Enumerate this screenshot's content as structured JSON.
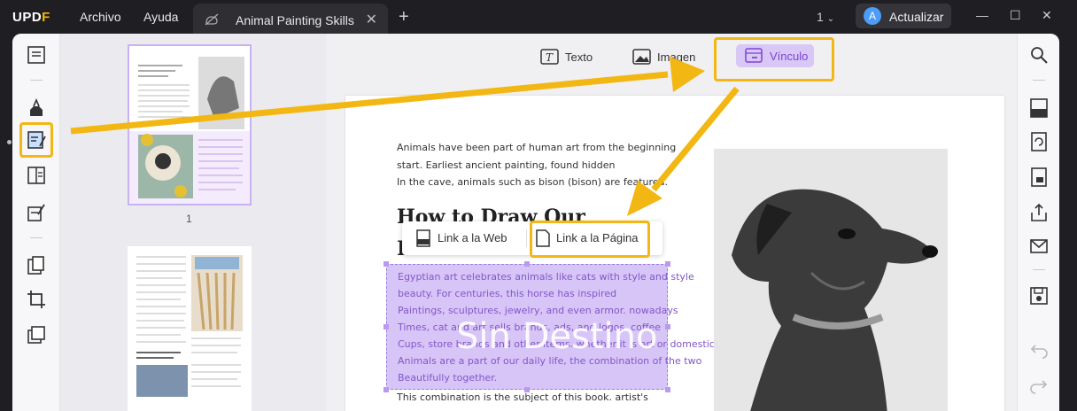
{
  "titlebar": {
    "logo": "UPDF",
    "menu": [
      "Archivo",
      "Ayuda"
    ],
    "tab_title": "Animal Painting Skills",
    "page_indicator": "1",
    "update_label": "Actualizar",
    "avatar_letter": "A"
  },
  "toolbar": {
    "text_label": "Texto",
    "image_label": "Imagen",
    "link_label": "Vínculo"
  },
  "thumbnails": [
    {
      "page": "1"
    },
    {
      "page": ""
    }
  ],
  "document": {
    "intro_lines": [
      "Animals have been part of human art from the beginning",
      "start. Earliest ancient painting, found hidden",
      "In the cave, animals such as bison (bison) are featured."
    ],
    "heading_lines": [
      "How to Draw Our",
      "F"
    ],
    "selected_lines": [
      "Egyptian art celebrates animals like cats with style and style",
      "beauty. For centuries, this horse has inspired",
      "Paintings, sculptures, jewelry, and even armor. nowadays",
      "Times, cat and art sells brands, ads, and logos. coffee",
      "Cups, store brands and other items. whether it is art or domestic",
      "Animals are a part of our daily life, the combination of the two",
      "Beautifully together."
    ],
    "after_line": "This combination is the subject of this book. artist's",
    "overlay_text": "Sin Destino"
  },
  "link_popup": {
    "web_label": "Link a la Web",
    "page_label": "Link a la Página"
  },
  "colors": {
    "accent_purple": "#7b43d6",
    "selection_fill": "#d8c5f7",
    "highlight_yellow": "#f2b712"
  }
}
